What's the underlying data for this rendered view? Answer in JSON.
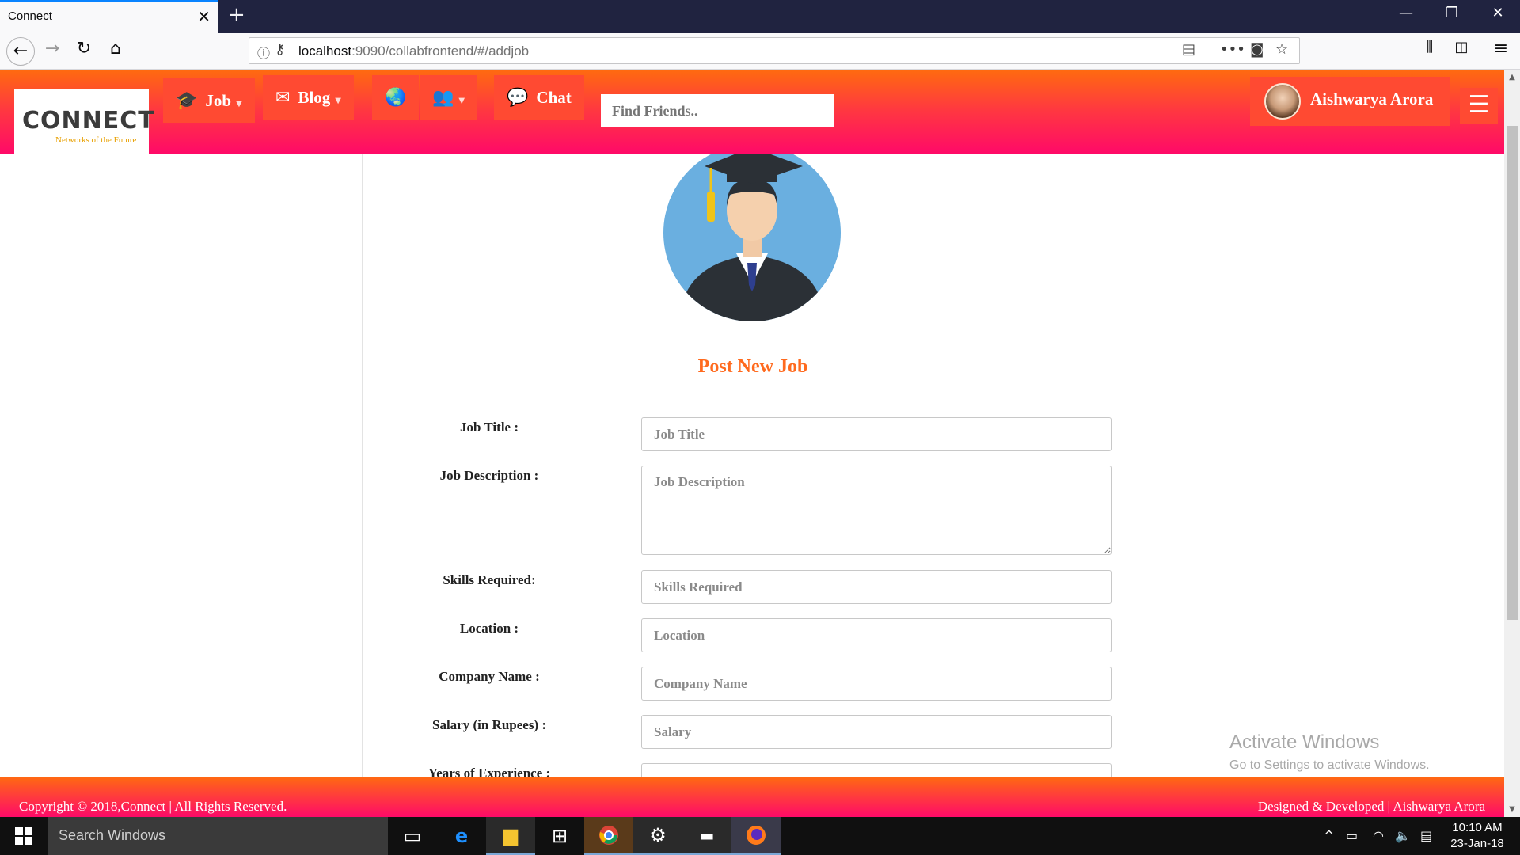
{
  "browser": {
    "tab_title": "Connect",
    "url_host": "localhost",
    "url_rest": ":9090/collabfrontend/#/addjob",
    "icons": [
      "back-icon",
      "forward-icon",
      "reload-icon",
      "home-icon",
      "info-icon",
      "key-icon",
      "reader-view-icon",
      "more-icon",
      "pocket-icon",
      "bookmark-star-icon",
      "library-icon",
      "sidebar-icon",
      "menu-icon"
    ]
  },
  "app": {
    "logo_text": "CONNECT",
    "logo_tagline": "Networks of the Future",
    "menu": {
      "job": "Job",
      "blog": "Blog",
      "chat": "Chat"
    },
    "search_placeholder": "Find Friends..",
    "user_name": "Aishwarya Arora",
    "accent_color": "#ff6a1e"
  },
  "form": {
    "title": "Post New Job",
    "fields": [
      {
        "label": "Job Title :",
        "placeholder": "Job Title"
      },
      {
        "label": "Job Description :",
        "placeholder": "Job Description"
      },
      {
        "label": "Skills Required:",
        "placeholder": "Skills Required"
      },
      {
        "label": "Location :",
        "placeholder": "Location"
      },
      {
        "label": "Company Name :",
        "placeholder": "Company Name"
      },
      {
        "label": "Salary (in Rupees) :",
        "placeholder": "Salary"
      },
      {
        "label": "Years of Experience :",
        "placeholder": ""
      }
    ]
  },
  "footer": {
    "left": "Copyright © 2018,Connect | All Rights Reserved.",
    "right": "Designed & Developed | Aishwarya Arora"
  },
  "watermark": {
    "title": "Activate Windows",
    "subtitle": "Go to Settings to activate Windows."
  },
  "taskbar": {
    "search": "Search Windows",
    "time": "10:10 AM",
    "date": "23-Jan-18"
  }
}
